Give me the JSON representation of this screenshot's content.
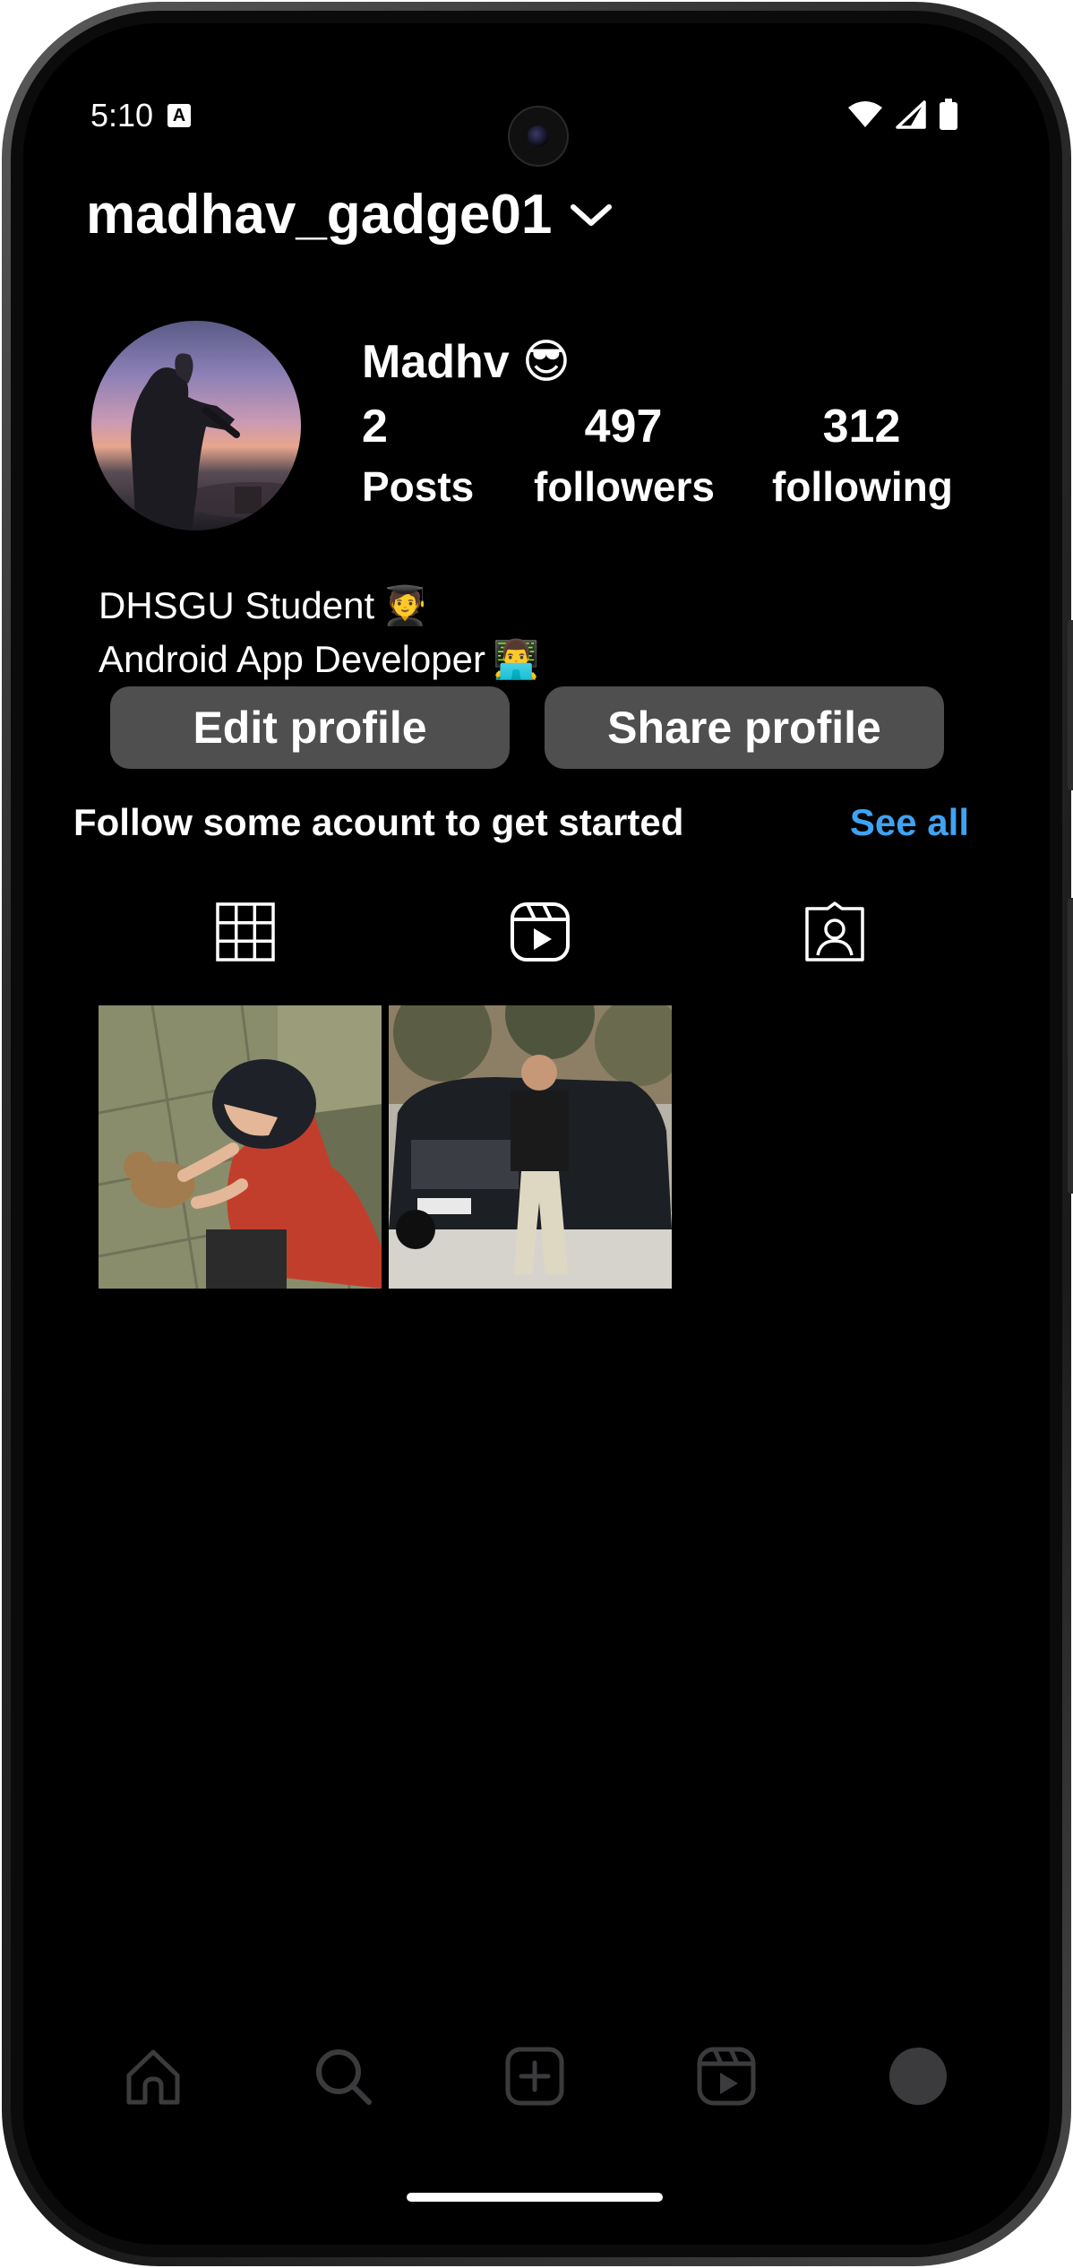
{
  "status_bar": {
    "time": "5:10",
    "badge": "A",
    "icons": [
      "wifi-icon",
      "signal-icon",
      "battery-icon"
    ]
  },
  "header": {
    "username": "madhav_gadge01",
    "switch_icon": "chevron-down-icon"
  },
  "profile": {
    "display_name": "Madhv",
    "name_emoji": "😎",
    "stats": [
      {
        "value": "2",
        "label": "Posts"
      },
      {
        "value": "497",
        "label": "followers"
      },
      {
        "value": "312",
        "label": "following"
      }
    ],
    "bio": [
      {
        "text": "DHSGU Student",
        "emoji": "🧑‍🎓"
      },
      {
        "text": "Android App Developer",
        "emoji": "👨‍💻"
      }
    ]
  },
  "actions": {
    "edit_profile": "Edit profile",
    "share_profile": "Share profile"
  },
  "suggestions": {
    "text": "Follow some acount to get started",
    "see_all": "See all"
  },
  "tabs": [
    "grid-icon",
    "reels-icon",
    "tagged-icon"
  ],
  "posts": [
    {
      "name": "post-illustration-cat"
    },
    {
      "name": "post-photo-car"
    }
  ],
  "bottom_nav": [
    "home-icon",
    "search-icon",
    "create-icon",
    "reels-icon",
    "profile-avatar"
  ],
  "colors": {
    "background": "#000000",
    "button": "#4f4f4f",
    "link": "#3fa3f3",
    "nav_icon": "#3b3b3e"
  }
}
